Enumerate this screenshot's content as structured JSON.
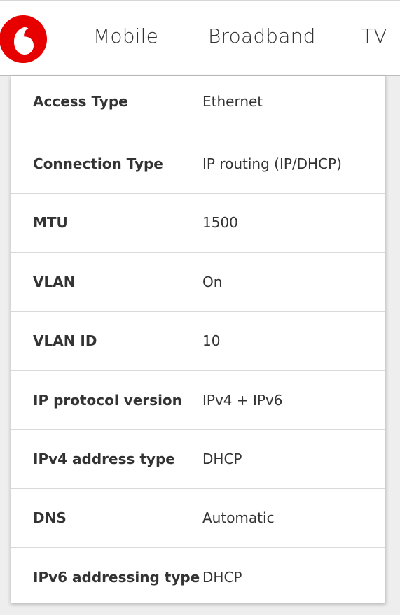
{
  "header": {
    "logo_icon": "vodafone-logo-icon",
    "brand_color": "#e60000",
    "nav": [
      {
        "label": "Mobile"
      },
      {
        "label": "Broadband"
      },
      {
        "label": "TV"
      }
    ]
  },
  "settings": {
    "rows": [
      {
        "label": "Access Type",
        "value": "Ethernet"
      },
      {
        "label": "Connection Type",
        "value": "IP routing (IP/DHCP)"
      },
      {
        "label": "MTU",
        "value": "1500"
      },
      {
        "label": "VLAN",
        "value": "On"
      },
      {
        "label": "VLAN ID",
        "value": "10"
      },
      {
        "label": "IP protocol version",
        "value": "IPv4 + IPv6"
      },
      {
        "label": "IPv4 address type",
        "value": "DHCP"
      },
      {
        "label": "DNS",
        "value": "Automatic"
      },
      {
        "label": "IPv6 addressing type",
        "value": "DHCP"
      }
    ]
  }
}
